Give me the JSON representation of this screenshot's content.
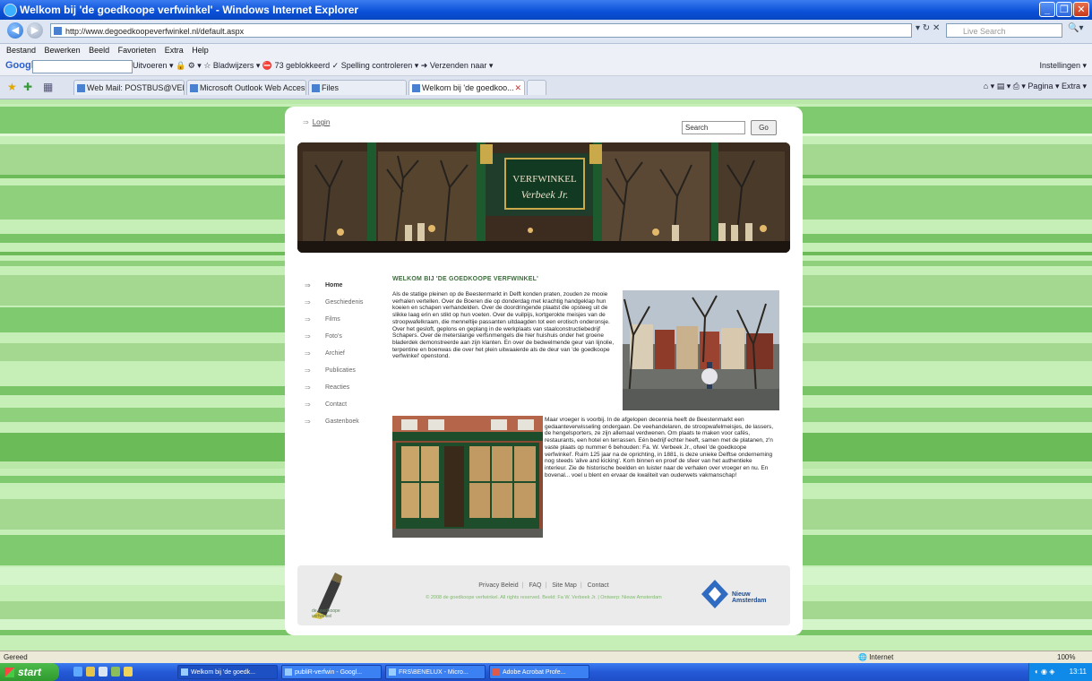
{
  "window": {
    "title": "Welkom bij 'de goedkoope verfwinkel' - Windows Internet Explorer"
  },
  "address": {
    "url": "http://www.degoedkoopeverfwinkel.nl/default.aspx",
    "live_search_placeholder": "Live Search"
  },
  "menu": {
    "items": [
      "Bestand",
      "Bewerken",
      "Beeld",
      "Favorieten",
      "Extra",
      "Help"
    ]
  },
  "google_toolbar": {
    "logo": "Google",
    "tools_text": "Uitvoeren ▾  🔒  ⚙  ▾   ☆ Bladwijzers ▾   ⛔ 73 geblokkeerd   ✓ Spelling controleren ▾   ➜ Verzenden naar ▾",
    "settings": "Instellingen ▾"
  },
  "tabs": [
    {
      "label": "Web Mail: POSTBUS@VERFW..."
    },
    {
      "label": "Microsoft Outlook Web Access"
    },
    {
      "label": "Files"
    },
    {
      "label": "Welkom bij 'de goedkoo..."
    }
  ],
  "command_bar": "⌂ ▾  ▤  ▾   ⎙ ▾  Pagina ▾  Extra ▾",
  "site": {
    "login": "Login",
    "search_value": "Search",
    "go_label": "Go",
    "nav": [
      "Home",
      "Geschiedenis",
      "Films",
      "Foto's",
      "Archief",
      "Publicaties",
      "Reacties",
      "Contact",
      "Gastenboek"
    ],
    "title": "WELKOM BIJ 'DE GOEDKOOPE VERFWINKEL'",
    "paragraph1": "Als de statige pleinen op de Beestenmarkt in Delft konden praten, zouden ze mooie verhalen vertellen. Over de Boeren die op donderdag met krachtig handgeklap hun koeien en schapen verhandelden. Over de doordringende plaatst die opsteeg uit de slikke laag erin en stikt op hun voeten. Over de vuilpijs, kortgerokte meisjes van de stroopwafelkraam, die menneltije passanten uitdaagden tot een erotisch onderonsje. Over het gesloft, geplons en geplang in de werkplaats van staalconstructiebedrijf Schapers. Over de meterslange verfsnmengels die hier huishuis onder het groene bladerdek demonstreerde aan zijn klanten. En over de bedwelmende geur van lijnolie, terpentine en boenwas die over het plein uitwaaierde als de deur van 'de goedkoope verfwinkel' openstond.",
    "paragraph2": "Maar vroeger is voorbij. In de afgelopen decennia heeft de Beestenmarkt een gedaanteverwisseling ondergaan. De veehandelaren, de stroopwafelmeisjes, de lassers, de hengelsporters, ze zijn allemaal verdwenen. Om plaats te maken voor cafés, restaurants, een hotel en terrassen. Eén bedrijf echter heeft, samen met de platanen, z'n vaste plaats op nummer 6 behouden: Fa. W. Verbeek Jr., ofwel 'de goedkoope verfwinkel'. Ruim 125 jaar na de oprichting, in 1881, is deze unieke Delftse onderneming nog steeds 'alive and kicking'. Kom binnen en proef de sfeer van het authentieke interieur. Zie de historische beelden en luister naar de verhalen over vroeger en nu. En bovenal... voel u blent en ervaar de kwaliteit van ouderwets vakmanschap!",
    "footer_links": [
      "Privacy Beleid",
      "FAQ",
      "Site Map",
      "Contact"
    ],
    "copyright": "© 2008 de goedkoope verfwinkel. All rights reserved. Beeld: Fa W. Verbeek Jr. | Ontwerp: Nieuw Amsterdam",
    "left_logo_text": "de goedkoope verfwinkel",
    "right_logo_text": "Nieuw Amsterdam",
    "banner_sign": "VERFWINKEL",
    "banner_sign2": "Verbeek Jr."
  },
  "status": {
    "left": "Gereed",
    "zone": "Internet",
    "zoom": "100%"
  },
  "taskbar": {
    "start": "start",
    "items": [
      "Welkom bij 'de goedk...",
      "publiR-verfwin - Googl...",
      "FRS\\BENELUX - Micro...",
      "Adobe Acrobat Profe..."
    ],
    "clock": "13:11"
  }
}
